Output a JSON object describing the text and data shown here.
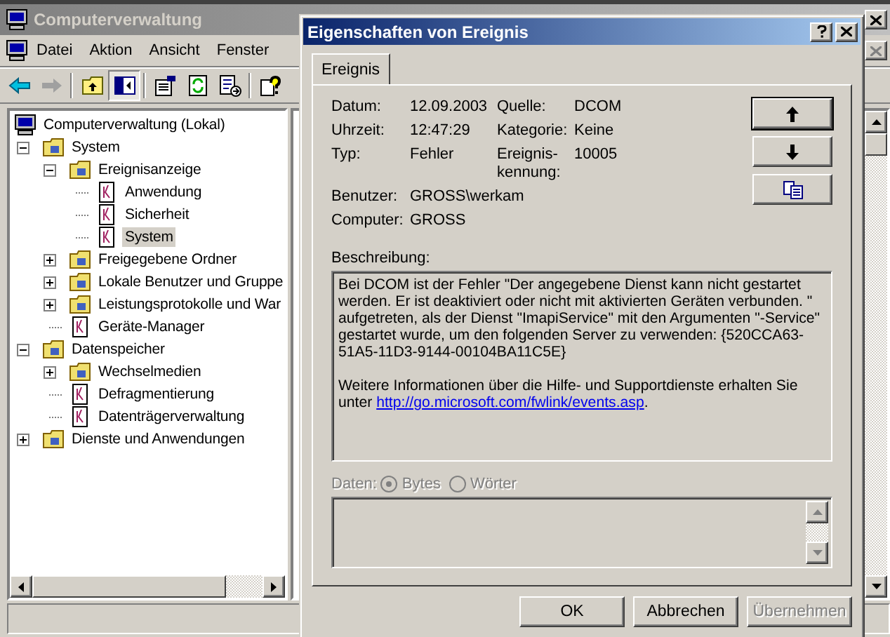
{
  "main_window": {
    "title": "Computerverwaltung",
    "menu": [
      "Datei",
      "Aktion",
      "Ansicht",
      "Fenster"
    ],
    "tree": {
      "label": "Computerverwaltung (Lokal)",
      "selected": false,
      "children": [
        {
          "label": "System",
          "selected": false,
          "expanded": true,
          "children": [
            {
              "label": "Ereignisanzeige",
              "selected": false,
              "expanded": true,
              "children": [
                {
                  "label": "Anwendung",
                  "selected": false
                },
                {
                  "label": "Sicherheit",
                  "selected": false
                },
                {
                  "label": "System",
                  "selected": true
                }
              ]
            },
            {
              "label": "Freigegebene Ordner",
              "selected": false,
              "expanded": false
            },
            {
              "label": "Lokale Benutzer und Gruppe",
              "selected": false,
              "expanded": false
            },
            {
              "label": "Leistungsprotokolle und War",
              "selected": false,
              "expanded": false
            },
            {
              "label": "Geräte-Manager",
              "selected": false
            }
          ]
        },
        {
          "label": "Datenspeicher",
          "selected": false,
          "expanded": true,
          "children": [
            {
              "label": "Wechselmedien",
              "selected": false,
              "expanded": false
            },
            {
              "label": "Defragmentierung",
              "selected": false
            },
            {
              "label": "Datenträgerverwaltung",
              "selected": false
            }
          ]
        },
        {
          "label": "Dienste und Anwendungen",
          "selected": false,
          "expanded": false
        }
      ]
    }
  },
  "dialog": {
    "title": "Eigenschaften von Ereignis",
    "tabs": [
      {
        "label": "Ereignis",
        "selected": true
      }
    ],
    "fields": [
      {
        "cells": [
          {
            "label": "Datum:",
            "value": "12.09.2003"
          },
          {
            "label": "Quelle:",
            "value": "DCOM"
          }
        ]
      },
      {
        "cells": [
          {
            "label": "Uhrzeit:",
            "value": "12:47:29"
          },
          {
            "label": "Kategorie:",
            "value": "Keine"
          }
        ]
      },
      {
        "cells": [
          {
            "label": "Typ:",
            "value": "Fehler"
          },
          {
            "label": "Ereignis-\nkennung:",
            "value": "10005"
          }
        ]
      },
      {
        "cells": [
          {
            "label": "Benutzer:",
            "value": "GROSS\\werkam"
          }
        ]
      },
      {
        "cells": [
          {
            "label": "Computer:",
            "value": "GROSS"
          }
        ]
      }
    ],
    "description": {
      "label": "Beschreibung:",
      "text": "Bei DCOM ist der Fehler \"Der angegebene Dienst kann nicht gestartet werden. Er ist deaktiviert oder nicht mit aktivierten Geräten verbunden. \" aufgetreten, als der Dienst \"ImapiService\" mit den Argumenten \"-Service\" gestartet wurde, um den folgenden Server zu verwenden: {520CCA63-51A5-11D3-9144-00104BA11C5E}",
      "more_info": {
        "text": "Weitere Informationen über die Hilfe- und Supportdienste erhalten Sie unter",
        "link": "http://go.microsoft.com/fwlink/events.asp",
        "after": "."
      }
    },
    "data": {
      "label": "Daten:",
      "disabled": true,
      "options": [
        {
          "label": "Bytes",
          "selected": true
        },
        {
          "label": "Wörter",
          "selected": false
        }
      ]
    },
    "buttons": [
      {
        "label": "OK",
        "disabled": false
      },
      {
        "label": "Abbrechen",
        "disabled": false
      },
      {
        "label": "Übernehmen",
        "disabled": true
      }
    ]
  }
}
